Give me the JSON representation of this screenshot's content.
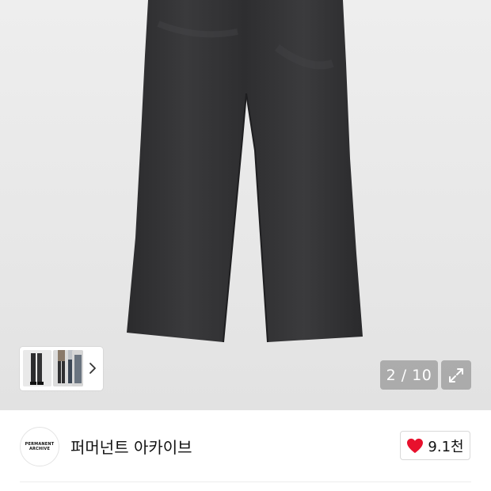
{
  "gallery": {
    "page_counter": "2 / 10",
    "thumb_chevron_icon": "chevron-right-icon",
    "expand_icon": "expand-icon"
  },
  "brand": {
    "logo_text_line1": "PERMANENT",
    "logo_text_line2": "ARCHIVE",
    "name": "퍼머넌트 아카이브"
  },
  "like": {
    "icon": "heart-icon",
    "count": "9.1천",
    "heart_color": "#e8112d"
  }
}
